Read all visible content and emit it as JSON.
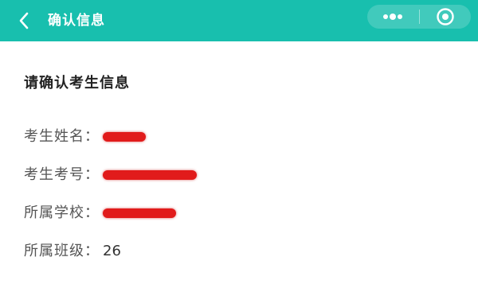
{
  "header": {
    "title": "确认信息",
    "back_icon": "chevron-left-icon",
    "more_icon": "more-dots-icon",
    "close_icon": "target-circle-icon",
    "color": "#18bfae"
  },
  "section": {
    "title": "请确认考生信息"
  },
  "fields": [
    {
      "label": "考生姓名：",
      "value": "",
      "redacted": true
    },
    {
      "label": "考生考号：",
      "value": "",
      "redacted": true
    },
    {
      "label": "所属学校：",
      "value": "",
      "redacted": true
    },
    {
      "label": "所属班级：",
      "value": "26",
      "redacted": false
    }
  ],
  "redaction_color": "#e11b1b"
}
